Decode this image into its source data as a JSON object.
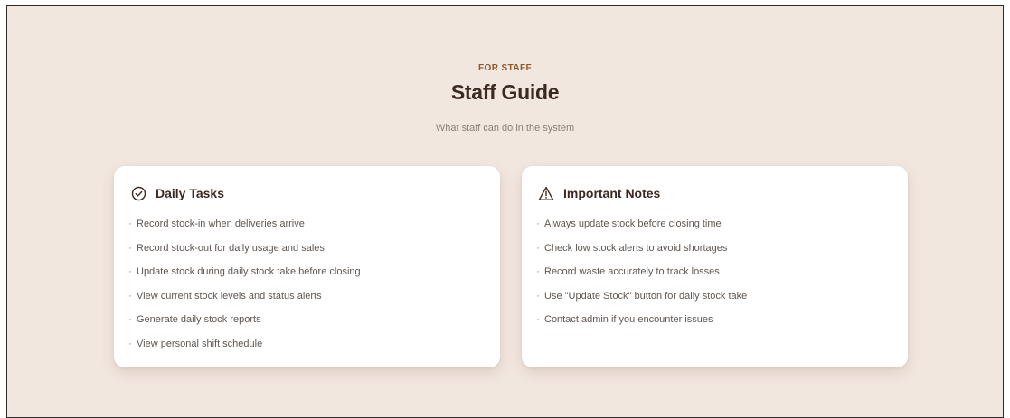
{
  "header": {
    "eyebrow": "FOR STAFF",
    "title": "Staff Guide",
    "subtitle": "What staff can do in the system"
  },
  "cards": [
    {
      "icon": "check-circle-icon",
      "title": "Daily Tasks",
      "items": [
        "Record stock-in when deliveries arrive",
        "Record stock-out for daily usage and sales",
        "Update stock during daily stock take before closing",
        "View current stock levels and status alerts",
        "Generate daily stock reports",
        "View personal shift schedule"
      ]
    },
    {
      "icon": "warning-triangle-icon",
      "title": "Important Notes",
      "items": [
        "Always update stock before closing time",
        "Check low stock alerts to avoid shortages",
        "Record waste accurately to track losses",
        "Use \"Update Stock\" button for daily stock take",
        "Contact admin if you encounter issues"
      ]
    }
  ],
  "colors": {
    "background": "#f2e7df",
    "accent": "#8b5a2b",
    "heading": "#3a2a22",
    "body_text": "#5f5650",
    "muted_text": "#8a7f77",
    "card": "#ffffff"
  }
}
